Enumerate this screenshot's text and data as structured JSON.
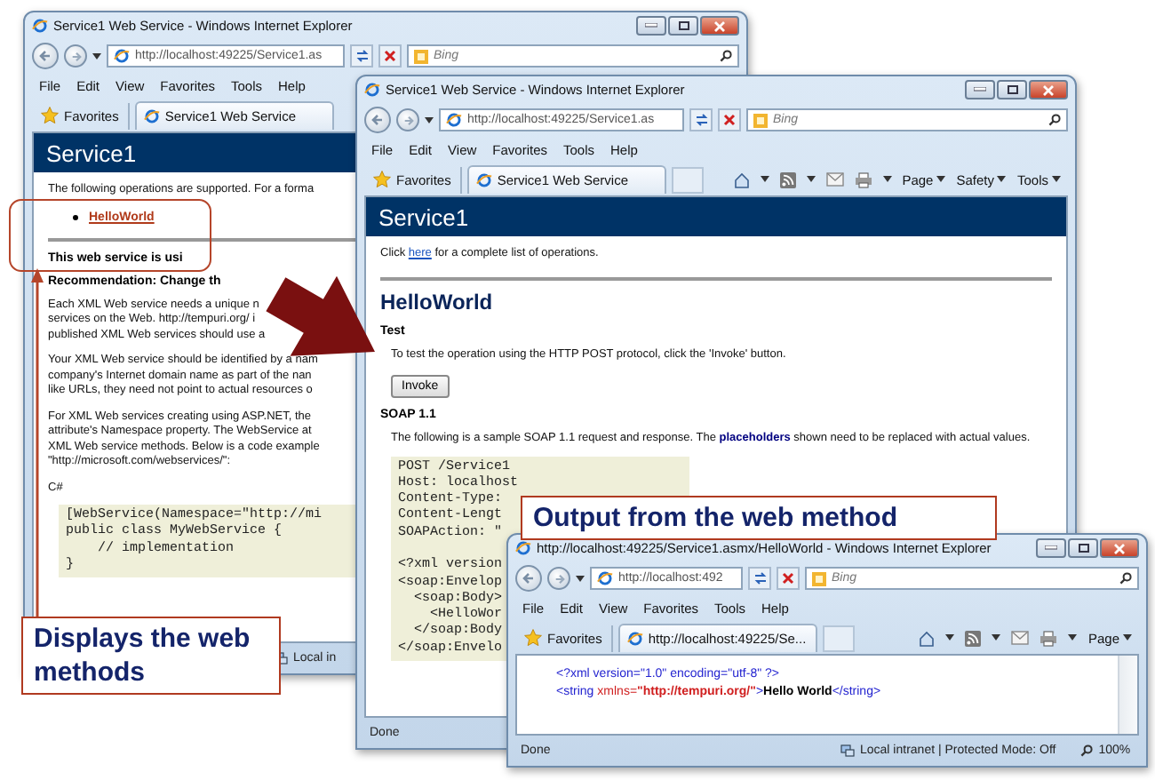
{
  "windows": [
    {
      "title": "Service1 Web Service - Windows Internet Explorer",
      "address": "http://localhost:49225/Service1.as",
      "search": "Bing",
      "menu": [
        "File",
        "Edit",
        "View",
        "Favorites",
        "Tools",
        "Help"
      ],
      "favorites": "Favorites",
      "tab": "Service1 Web Service",
      "content": [
        {
          "kind": "banner",
          "text": "Service1"
        },
        {
          "kind": "text",
          "text": "The following operations are supported. For a forma"
        },
        {
          "kind": "bullets",
          "items": [
            "HelloWorld"
          ]
        },
        {
          "kind": "rule"
        },
        {
          "kind": "bold",
          "text": "This web service is usi"
        },
        {
          "kind": "bold",
          "text": "Recommendation: Change th"
        },
        {
          "kind": "lines",
          "lines": [
            "Each XML Web service needs a unique n",
            "services on the Web. http://tempuri.org/ i",
            "published XML Web services should use a"
          ]
        },
        {
          "kind": "lines",
          "lines": [
            "Your XML Web service should be identified by a nam",
            "company's Internet domain name as part of the nan",
            "like URLs, they need not point to actual resources o"
          ]
        },
        {
          "kind": "lines",
          "lines": [
            "For XML Web services creating using ASP.NET, the",
            "attribute's Namespace property. The WebService at",
            "XML Web service methods. Below is a code example",
            "\"http://microsoft.com/webservices/\":"
          ]
        },
        {
          "kind": "text",
          "text": "C#"
        },
        {
          "kind": "section",
          "children": [
            {
              "kind": "code",
              "groups": [
                [
                  "[WebService(Namespace=\"http://mi",
                  "public class MyWebService {",
                  "    // implementation",
                  "}"
                ]
              ]
            }
          ]
        }
      ],
      "status": {
        "zone": "Local in"
      }
    },
    {
      "title": "Service1 Web Service - Windows Internet Explorer",
      "address": "http://localhost:49225/Service1.as",
      "search": "Bing",
      "menu": [
        "File",
        "Edit",
        "View",
        "Favorites",
        "Tools",
        "Help"
      ],
      "favorites": "Favorites",
      "tab": "Service1 Web Service",
      "commands": [
        "Page",
        "Safety",
        "Tools"
      ],
      "content": [
        {
          "kind": "banner",
          "text": "Service1"
        },
        {
          "kind": "rich",
          "parts": [
            {
              "kind": "text",
              "text": "Click "
            },
            {
              "kind": "link",
              "text": "here"
            },
            {
              "kind": "text",
              "text": " for a complete list of operations."
            }
          ]
        },
        {
          "kind": "rule"
        },
        {
          "kind": "heading",
          "text": "HelloWorld"
        },
        {
          "kind": "bold",
          "text": "Test"
        },
        {
          "kind": "section",
          "children": [
            {
              "kind": "text",
              "text": "To test the operation using the HTTP POST protocol, click the 'Invoke' button."
            },
            {
              "kind": "button",
              "text": "Invoke"
            }
          ]
        },
        {
          "kind": "bold",
          "text": "SOAP 1.1"
        },
        {
          "kind": "section",
          "children": [
            {
              "kind": "rich",
              "parts": [
                {
                  "kind": "text",
                  "text": "The following is a sample SOAP 1.1 request and response. The "
                },
                {
                  "kind": "term",
                  "text": "placeholders"
                },
                {
                  "kind": "text",
                  "text": " shown need to be replaced with actual values."
                }
              ]
            },
            {
              "kind": "code",
              "groups": [
                [
                  "POST /Service1",
                  "Host: localhost",
                  "Content-Type:",
                  "Content-Lengt",
                  "SOAPAction: \""
                ],
                [
                  "<?xml version",
                  "<soap:Envelop",
                  "  <soap:Body>",
                  "    <HelloWor",
                  "  </soap:Body",
                  "</soap:Envelo"
                ]
              ]
            }
          ]
        }
      ],
      "status": {
        "text": "Done"
      }
    },
    {
      "title": "http://localhost:49225/Service1.asmx/HelloWorld - Windows Internet Explorer",
      "address": "http://localhost:492",
      "search": "Bing",
      "menu": [
        "File",
        "Edit",
        "View",
        "Favorites",
        "Tools",
        "Help"
      ],
      "favorites": "Favorites",
      "tab": "http://localhost:49225/Se...",
      "commands": [
        "Page"
      ],
      "content": [
        {
          "kind": "xml",
          "lines": [
            [
              {
                "kind": "tag",
                "text": "<?xml version=\"1.0\" encoding=\"utf-8\" ?>"
              }
            ],
            [
              {
                "kind": "tag",
                "text": "<string"
              },
              {
                "kind": "attr",
                "text": " xmlns="
              },
              {
                "kind": "value",
                "text": "\"http://tempuri.org/\""
              },
              {
                "kind": "tag",
                "text": ">"
              },
              {
                "kind": "text",
                "text": "Hello World"
              },
              {
                "kind": "tag",
                "text": "</string>"
              }
            ]
          ]
        }
      ],
      "status": {
        "text": "Done",
        "zone": "Local intranet | Protected Mode: Off",
        "zoom": "100%"
      }
    }
  ],
  "callouts": [
    {
      "text": "Displays the web methods"
    },
    {
      "text": "Output from the web method"
    }
  ]
}
